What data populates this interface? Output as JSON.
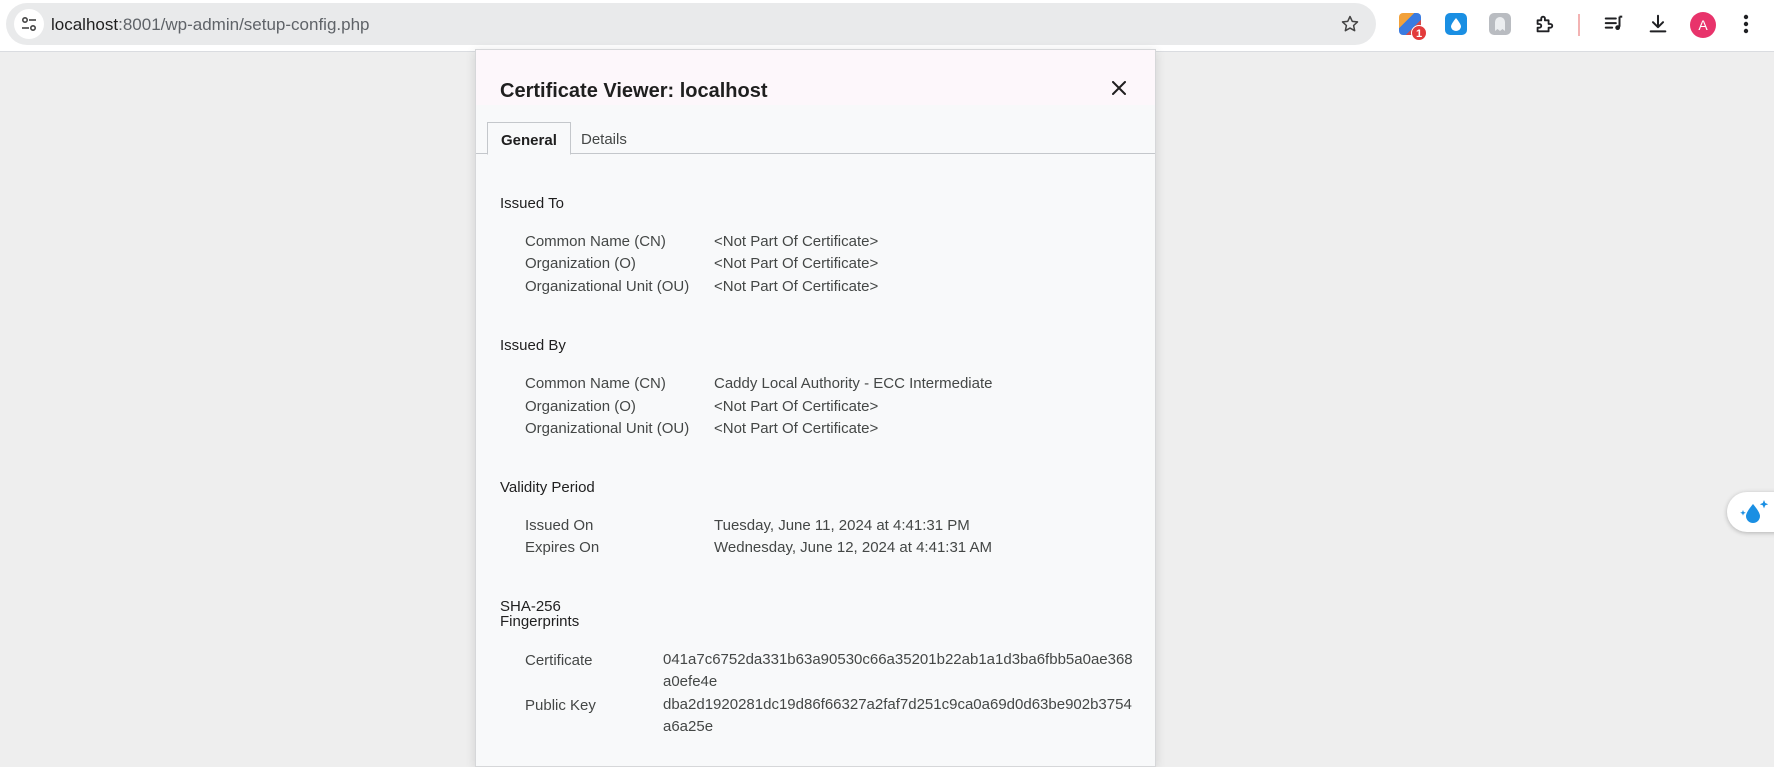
{
  "browser": {
    "url_host": "localhost",
    "url_path": ":8001/wp-admin/setup-config.php",
    "extension_badge": "1",
    "profile_initial": "A",
    "icons": [
      "site-info-icon",
      "bookmark-star-icon",
      "extension-icon",
      "water-drop-icon",
      "ghost-icon",
      "puzzle-icon",
      "media-queue-icon",
      "download-icon",
      "menu-icon"
    ],
    "colors": {
      "avatar": "#e8336b",
      "badge": "#e33b3b",
      "drop": "#1a8fe3"
    }
  },
  "dialog": {
    "title": "Certificate Viewer: localhost",
    "tabs": [
      {
        "label": "General",
        "active": true
      },
      {
        "label": "Details",
        "active": false
      }
    ],
    "issued_to": {
      "title": "Issued To",
      "rows": [
        {
          "label": "Common Name (CN)",
          "value": "<Not Part Of Certificate>"
        },
        {
          "label": "Organization (O)",
          "value": "<Not Part Of Certificate>"
        },
        {
          "label": "Organizational Unit (OU)",
          "value": "<Not Part Of Certificate>"
        }
      ]
    },
    "issued_by": {
      "title": "Issued By",
      "rows": [
        {
          "label": "Common Name (CN)",
          "value": "Caddy Local Authority - ECC Intermediate"
        },
        {
          "label": "Organization (O)",
          "value": "<Not Part Of Certificate>"
        },
        {
          "label": "Organizational Unit (OU)",
          "value": "<Not Part Of Certificate>"
        }
      ]
    },
    "validity": {
      "title": "Validity Period",
      "rows": [
        {
          "label": "Issued On",
          "value": "Tuesday, June 11, 2024 at 4:41:31 PM"
        },
        {
          "label": "Expires On",
          "value": "Wednesday, June 12, 2024 at 4:41:31 AM"
        }
      ]
    },
    "fingerprints": {
      "title_line1": "SHA-256",
      "title_line2": "Fingerprints",
      "rows": [
        {
          "label": "Certificate",
          "value": "041a7c6752da331b63a90530c66a35201b22ab1a1d3ba6fbb5a0ae368a0efe4e"
        },
        {
          "label": "Public Key",
          "value": "dba2d1920281dc19d86f66327a2faf7d251c9ca0a69d0d63be902b3754a6a25e"
        }
      ]
    }
  }
}
